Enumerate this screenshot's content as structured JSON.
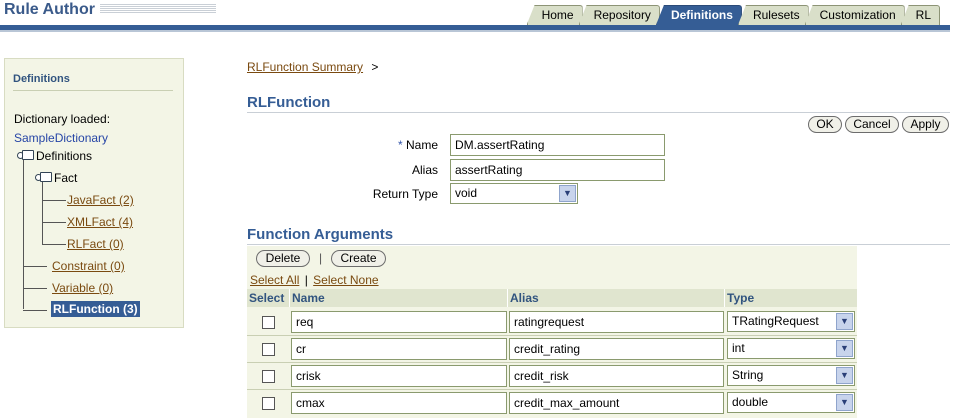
{
  "app": {
    "title": "Rule Author"
  },
  "tabs": [
    {
      "label": "Home",
      "active": false
    },
    {
      "label": "Repository",
      "active": false
    },
    {
      "label": "Definitions",
      "active": true
    },
    {
      "label": "Rulesets",
      "active": false
    },
    {
      "label": "Customization",
      "active": false
    },
    {
      "label": "RL",
      "active": false
    }
  ],
  "sidebar": {
    "title": "Definitions",
    "dictionary_label": "Dictionary loaded:",
    "dictionary_name": "SampleDictionary",
    "tree": {
      "root": "Definitions",
      "fact": "Fact",
      "java_fact": "JavaFact (2)",
      "xml_fact": "XMLFact (4)",
      "rl_fact": "RLFact (0)",
      "constraint": "Constraint (0)",
      "variable": "Variable (0)",
      "rl_function": "RLFunction (3)"
    }
  },
  "breadcrumb": {
    "link": "RLFunction Summary",
    "separator": ">"
  },
  "function": {
    "heading": "RLFunction",
    "buttons": {
      "ok": "OK",
      "cancel": "Cancel",
      "apply": "Apply"
    },
    "required_marker": "*",
    "name_label": "Name",
    "name_value": "DM.assertRating",
    "alias_label": "Alias",
    "alias_value": "assertRating",
    "return_type_label": "Return Type",
    "return_type_value": "void"
  },
  "arguments": {
    "heading": "Function Arguments",
    "delete_label": "Delete",
    "toolbar_sep": "|",
    "create_label": "Create",
    "select_all": "Select All",
    "link_sep": "|",
    "select_none": "Select None",
    "columns": {
      "select": "Select",
      "name": "Name",
      "alias": "Alias",
      "type": "Type"
    },
    "rows": [
      {
        "name": "req",
        "alias": "ratingrequest",
        "type": "TRatingRequest",
        "selected": false
      },
      {
        "name": "cr",
        "alias": "credit_rating",
        "type": "int",
        "selected": false
      },
      {
        "name": "crisk",
        "alias": "credit_risk",
        "type": "String",
        "selected": false
      },
      {
        "name": "cmax",
        "alias": "credit_max_amount",
        "type": "double",
        "selected": false
      }
    ]
  },
  "colors": {
    "accent": "#355d95",
    "panel": "#f3f5e6",
    "link": "#7a4a10"
  }
}
